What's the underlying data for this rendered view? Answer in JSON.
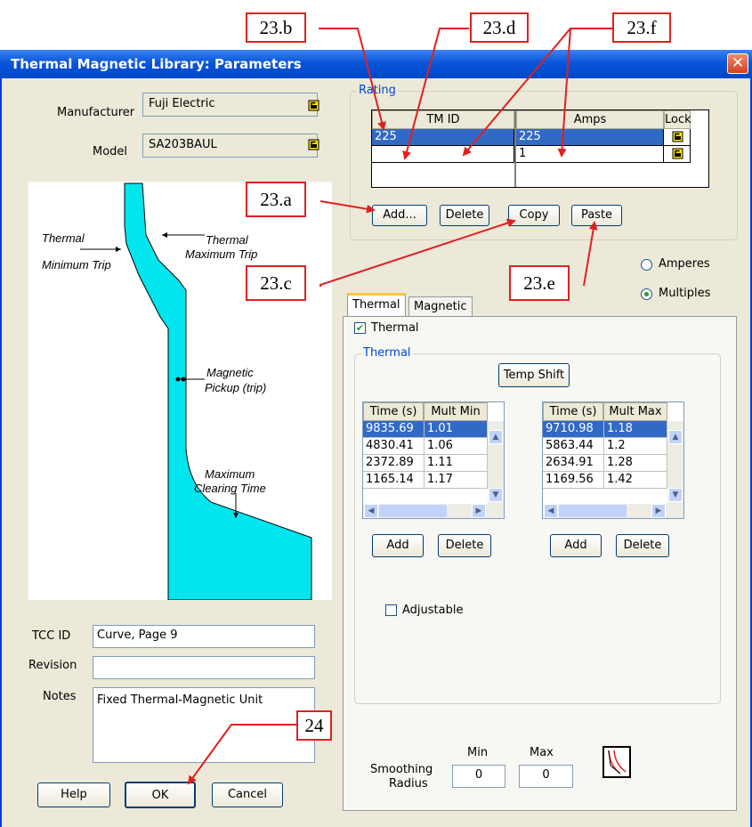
{
  "window": {
    "title": "Thermal Magnetic Library: Parameters",
    "close_glyph": "✕"
  },
  "manufacturer": {
    "label": "Manufacturer",
    "value": "Fuji Electric"
  },
  "model": {
    "label": "Model",
    "value": "SA203BAUL"
  },
  "curve": {
    "thermal_min": [
      "Thermal",
      "Minimum Trip"
    ],
    "thermal_max": [
      "Thermal",
      "Maximum Trip"
    ],
    "magnetic": [
      "Magnetic",
      "Pickup (trip)"
    ],
    "clearing": [
      "Maximum",
      "Clearing Time"
    ],
    "fill_color": "#00e5ee"
  },
  "tcc": {
    "label": "TCC ID",
    "value": "Curve, Page 9"
  },
  "revision": {
    "label": "Revision",
    "value": ""
  },
  "notes": {
    "label": "Notes",
    "value": "Fixed Thermal-Magnetic Unit"
  },
  "buttons": {
    "help": "Help",
    "ok": "OK",
    "cancel": "Cancel"
  },
  "rating": {
    "group_label": "Rating",
    "headers": [
      "TM ID",
      "Amps",
      "Lock"
    ],
    "rows": [
      {
        "tm_id": "225",
        "amps": "225"
      },
      {
        "tm_id": "",
        "amps": "1"
      }
    ],
    "add": "Add...",
    "delete": "Delete",
    "copy": "Copy",
    "paste": "Paste"
  },
  "units": {
    "amperes": "Amperes",
    "multiples": "Multiples",
    "selected": "Multiples"
  },
  "tabs": {
    "thermal": "Thermal",
    "magnetic": "Magnetic"
  },
  "thermal_panel": {
    "enable_label": "Thermal",
    "group_label": "Thermal",
    "temp_shift": "Temp Shift",
    "min_table": {
      "headers": [
        "Time (s)",
        "Mult Min"
      ],
      "rows": [
        [
          "9835.69",
          "1.01"
        ],
        [
          "4830.41",
          "1.06"
        ],
        [
          "2372.89",
          "1.11"
        ],
        [
          "1165.14",
          "1.17"
        ]
      ]
    },
    "max_table": {
      "headers": [
        "Time (s)",
        "Mult Max"
      ],
      "rows": [
        [
          "9710.98",
          "1.18"
        ],
        [
          "5863.44",
          "1.2"
        ],
        [
          "2634.91",
          "1.28"
        ],
        [
          "1169.56",
          "1.42"
        ]
      ]
    },
    "add": "Add",
    "delete": "Delete",
    "adjustable": "Adjustable"
  },
  "smoothing": {
    "label_line1": "Smoothing",
    "label_line2": "Radius",
    "min_label": "Min",
    "max_label": "Max",
    "min_value": "0",
    "max_value": "0"
  },
  "annotations": {
    "a23a": "23.a",
    "a23b": "23.b",
    "a23c": "23.c",
    "a23d": "23.d",
    "a23e": "23.e",
    "a23f": "23.f",
    "a24": "24",
    "color": "#e02020"
  }
}
